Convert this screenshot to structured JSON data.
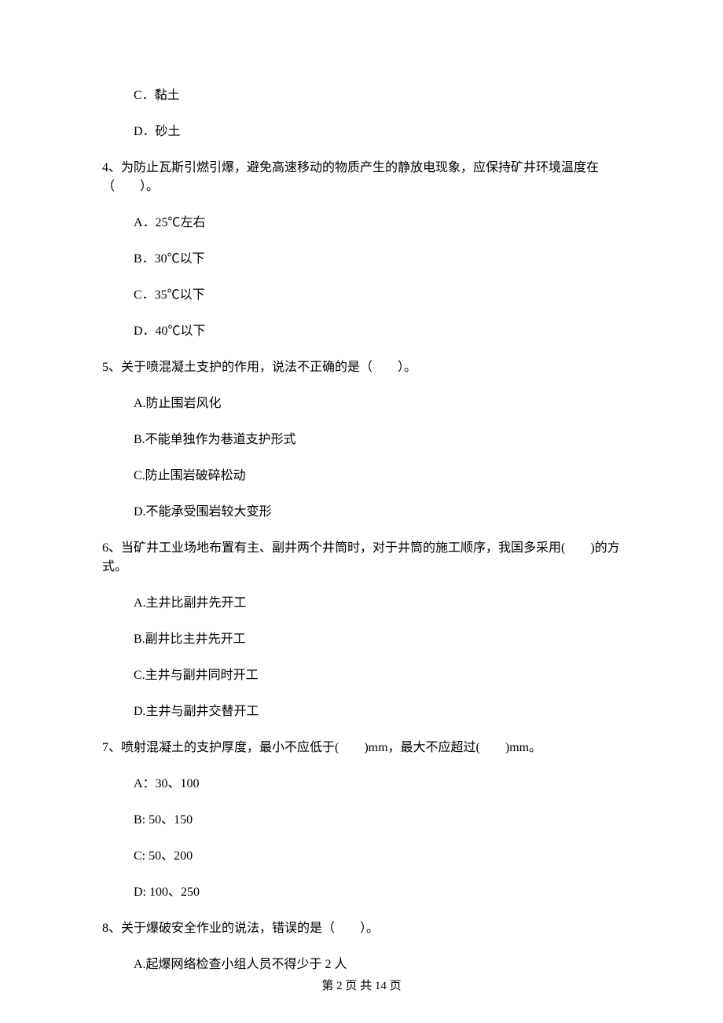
{
  "q3": {
    "optC": "C．黏土",
    "optD": "D．砂土"
  },
  "q4": {
    "text": "4、为防止瓦斯引燃引爆，避免高速移动的物质产生的静放电现象，应保持矿井环境温度在（　　）。",
    "optA": "A．25℃左右",
    "optB": "B．30℃以下",
    "optC": "C．35℃以下",
    "optD": "D．40℃以下"
  },
  "q5": {
    "text": "5、关于喷混凝土支护的作用，说法不正确的是（　　）。",
    "optA": "A.防止围岩风化",
    "optB": "B.不能单独作为巷道支护形式",
    "optC": "C.防止围岩破碎松动",
    "optD": "D.不能承受围岩较大变形"
  },
  "q6": {
    "text": "6、当矿井工业场地布置有主、副井两个井筒时，对于井筒的施工顺序，我国多采用(　　)的方式。",
    "optA": "A.主井比副井先开工",
    "optB": "B.副井比主井先开工",
    "optC": "C.主井与副井同时开工",
    "optD": "D.主井与副井交替开工"
  },
  "q7": {
    "text": "7、喷射混凝土的支护厚度，最小不应低于(　　)mm，最大不应超过(　　)mm。",
    "optA": "A：30、100",
    "optB": "B: 50、150",
    "optC": "C: 50、200",
    "optD": "D: 100、250"
  },
  "q8": {
    "text": "8、关于爆破安全作业的说法，错误的是（　　）。",
    "optA": "A.起爆网络检查小组人员不得少于 2 人"
  },
  "footer": "第 2 页 共 14 页"
}
